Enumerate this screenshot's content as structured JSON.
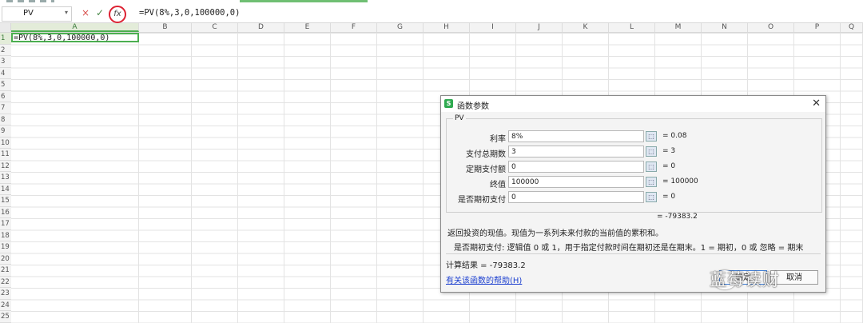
{
  "formula_bar": {
    "name_box": "PV",
    "formula": "=PV(8%,3,0,100000,0)",
    "cancel_icon": "×",
    "confirm_icon": "✓",
    "fx_label": "fx"
  },
  "columns": [
    "A",
    "B",
    "C",
    "D",
    "E",
    "F",
    "G",
    "H",
    "I",
    "J",
    "K",
    "L",
    "M",
    "N",
    "O",
    "P",
    "Q"
  ],
  "rows": [
    "1",
    "2",
    "3",
    "4",
    "5",
    "6",
    "7",
    "8",
    "9",
    "10",
    "11",
    "12",
    "13",
    "14",
    "15",
    "16",
    "17",
    "18",
    "19",
    "20",
    "21",
    "22",
    "23",
    "24",
    "25"
  ],
  "cell_a1": "=PV(8%,3,0,100000,0)",
  "dialog": {
    "title": "函数参数",
    "logo_letter": "S",
    "close_icon": "✕",
    "group_label": "PV",
    "args": [
      {
        "label": "利率",
        "value": "8%",
        "result": "= 0.08"
      },
      {
        "label": "支付总期数",
        "value": "3",
        "result": "= 3"
      },
      {
        "label": "定期支付额",
        "value": "0",
        "result": "= 0"
      },
      {
        "label": "终值",
        "value": "100000",
        "result": "= 100000"
      },
      {
        "label": "是否期初支付",
        "value": "0",
        "result": "= 0"
      }
    ],
    "formula_result": "= -79383.2",
    "description": "返回投资的现值。现值为一系列未来付款的当前值的累积和。",
    "arg_description": "是否期初支付:  逻辑值 0 或 1，用于指定付款时间在期初还是在期末。1 = 期初，0 或 忽略 = 期末",
    "calc_result": "计算结果 = -79383.2",
    "help_link": "有关该函数的帮助(H)",
    "ok_button": "确定",
    "cancel_button": "取消"
  },
  "watermark": "蓝莓读财"
}
